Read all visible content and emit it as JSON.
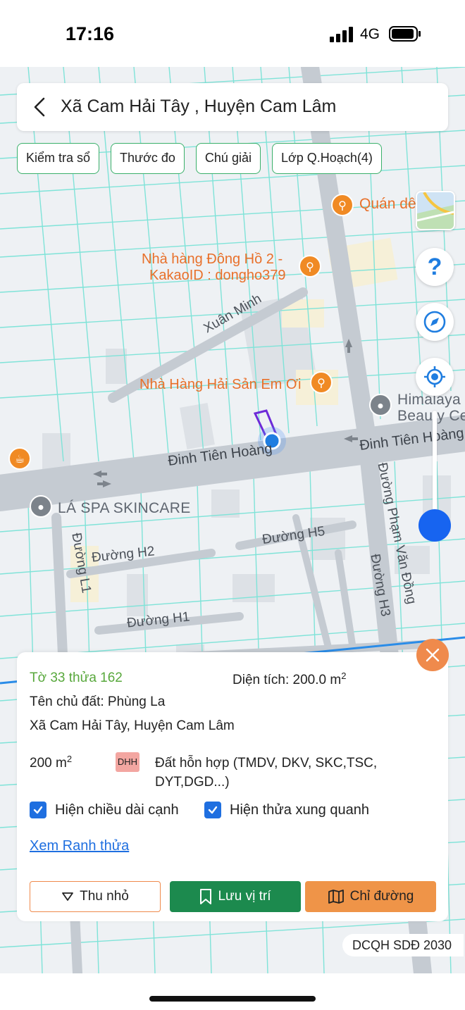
{
  "status": {
    "time": "17:16",
    "network": "4G"
  },
  "header": {
    "title": "Xã Cam Hải Tây , Huyện Cam Lâm"
  },
  "chips": [
    {
      "label": "Kiểm tra sổ"
    },
    {
      "label": "Thước đo"
    },
    {
      "label": "Chú giải"
    },
    {
      "label": "Lớp Q.Hoạch(4)"
    }
  ],
  "map": {
    "pois": {
      "quan_de": "Quán dê",
      "dong_ho_line1": "Nhà hàng Đông Hồ 2 -",
      "dong_ho_line2": "KakaoID : dongho379",
      "em_oi": "Nhà Hàng Hải Sản Em Ơi",
      "himalaya_line1": "Himalaya",
      "himalaya_line2": "Beauty Ce",
      "la_spa": "LÁ SPA SKINCARE"
    },
    "roads": {
      "xuan_minh": "Xuân Minh",
      "dinh_tien_hoang_left": "Đinh Tiên Hoàng",
      "dinh_tien_hoang_right": "Đinh Tiên Hoàng",
      "pham_van_dong": "Đường Phạm Văn Đồng",
      "h5": "Đường H5",
      "h2": "Đường H2",
      "h1": "Đường H1",
      "h3": "Đường H3",
      "l1": "Đường L1"
    },
    "help_label": "?"
  },
  "parcel": {
    "id": "Tờ 33 thửa 162",
    "area_prefix": "Diện tích: 200.0 m",
    "area_sup": "2",
    "owner": "Tên chủ đất: Phùng La",
    "address": "Xã Cam Hải Tây, Huyện Cam Lâm",
    "landuse_area": "200 m",
    "landuse_area_sup": "2",
    "landuse_code": "DHH",
    "landuse_desc": "Đất hỗn hợp (TMDV, DKV, SKC,TSC, DYT,DGD...)",
    "show_edge_length": "Hiện chiều dài cạnh",
    "show_neighbors": "Hiện thửa xung quanh",
    "view_boundary": "Xem Ranh thửa"
  },
  "actions": {
    "collapse": "Thu nhỏ",
    "save": "Lưu vị trí",
    "route": "Chỉ đường"
  },
  "plan_layer": "DCQH SDĐ 2030",
  "colors": {
    "accent_blue": "#1764f0",
    "chip_border": "#3ab06a",
    "save_green": "#1c8a4e",
    "route_orange": "#ef9448",
    "poi_orange": "#e8702a",
    "parcel_line": "#7fe3d8"
  }
}
